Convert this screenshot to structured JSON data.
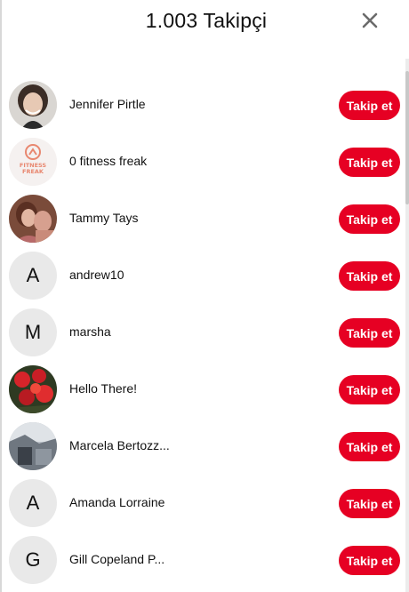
{
  "header": {
    "title": "1.003 Takipçi"
  },
  "followers": [
    {
      "name": "Jennifer Pirtle",
      "avatar": "photo-woman-portrait-icon",
      "initial": ""
    },
    {
      "name": "0 fitness freak",
      "avatar": "fitness-freak-logo-icon",
      "initial": "",
      "logo_text": "FITNESS\nFREAK"
    },
    {
      "name": "Tammy Tays",
      "avatar": "photo-people-icon",
      "initial": ""
    },
    {
      "name": "andrew10",
      "avatar": "letter",
      "initial": "A"
    },
    {
      "name": "marsha",
      "avatar": "letter",
      "initial": "M"
    },
    {
      "name": "Hello There!",
      "avatar": "photo-red-flowers-icon",
      "initial": ""
    },
    {
      "name": "Marcela Bertozz...",
      "avatar": "photo-scenery-icon",
      "initial": ""
    },
    {
      "name": "Amanda Lorraine",
      "avatar": "letter",
      "initial": "A"
    },
    {
      "name": "Gill Copeland P...",
      "avatar": "letter",
      "initial": "G"
    }
  ],
  "follow_label": "Takip et",
  "colors": {
    "accent": "#e60023",
    "avatar_bg": "#e9e9e9"
  }
}
